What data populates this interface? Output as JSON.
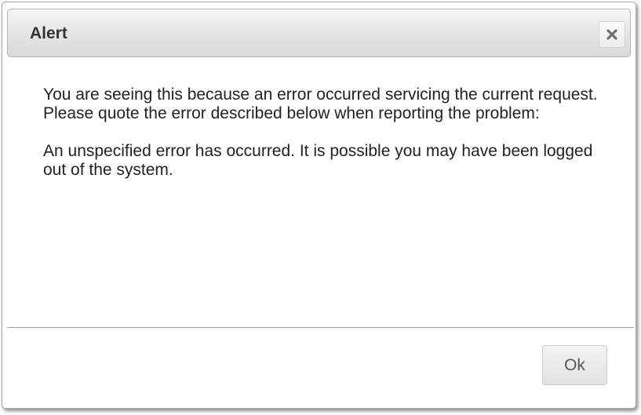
{
  "dialog": {
    "title": "Alert",
    "close_icon": "close-icon",
    "message_lines": [
      "You are seeing this because an error occurred servicing the current request.",
      "Please quote the error described below when reporting the problem:",
      "An unspecified error has occurred. It is possible you may have been logged out of the system."
    ],
    "ok_label": "Ok"
  },
  "colors": {
    "titlebar_top": "#f6f6f6",
    "titlebar_bottom": "#d9d9d9",
    "text": "#222222",
    "border": "#a9a9a9"
  }
}
